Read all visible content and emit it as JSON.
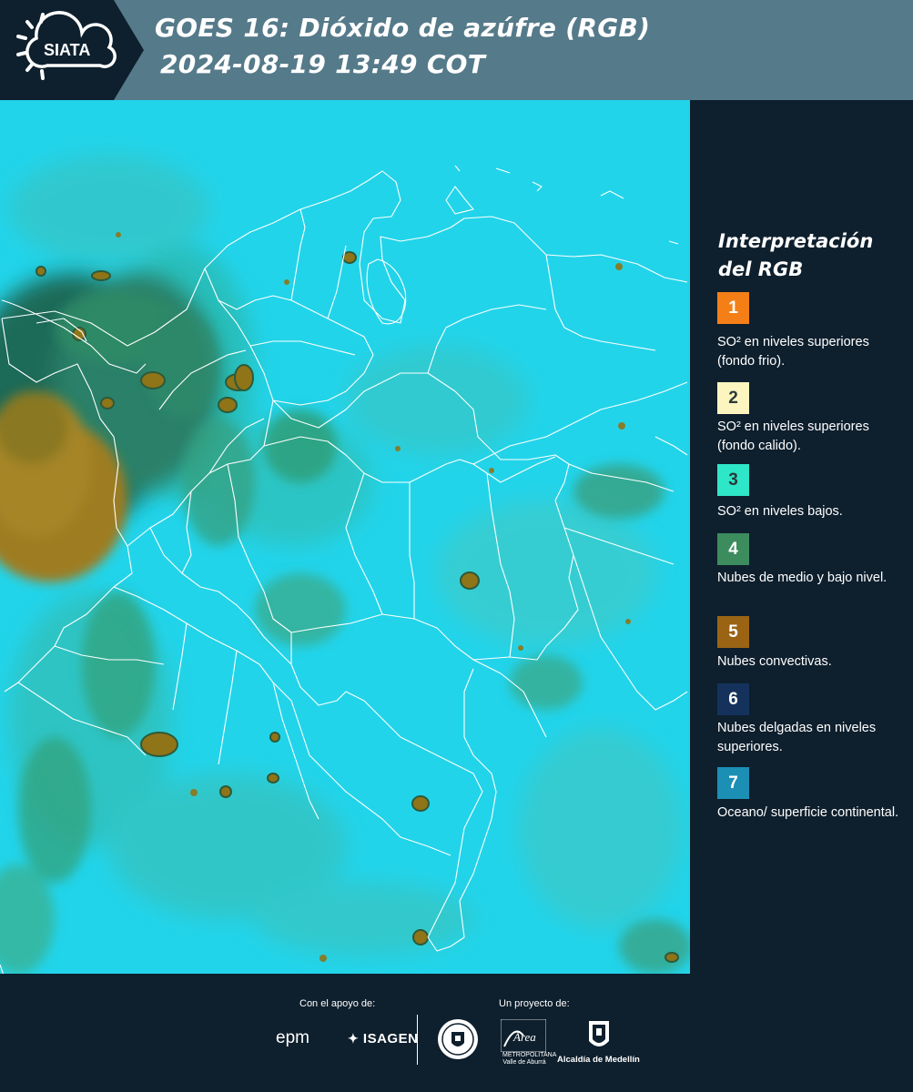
{
  "header": {
    "logo_text": "SIATA",
    "title_line1": "GOES 16: Dióxido de azúfre (RGB)",
    "title_line2": "2024-08-19 13:49 COT"
  },
  "legend": {
    "title": "Interpretación del RGB",
    "items": [
      {
        "num": "1",
        "color": "#f57f17",
        "text": "SO² en niveles superiores (fondo frio)."
      },
      {
        "num": "2",
        "color": "#fdf5c0",
        "text": "SO² en niveles superiores (fondo calido)."
      },
      {
        "num": "3",
        "color": "#2ee6c8",
        "text": "SO² en niveles bajos."
      },
      {
        "num": "4",
        "color": "#3c8c5e",
        "text": "Nubes de medio y bajo nivel."
      },
      {
        "num": "5",
        "color": "#9a6414",
        "text": "Nubes convectivas."
      },
      {
        "num": "6",
        "color": "#14325c",
        "text": "Nubes delgadas en niveles superiores."
      },
      {
        "num": "7",
        "color": "#1c8fb5",
        "text": "Oceano/ superficie continental."
      }
    ]
  },
  "footer": {
    "support_label": "Con el apoyo de:",
    "project_label": "Un proyecto de:",
    "sponsor1": "epm",
    "sponsor2": "ISAGEN",
    "area_logo": "Área",
    "area_sub": "METROPOLITANA Valle de Aburrá",
    "alcaldia": "Alcaldía de Medellín"
  },
  "map": {
    "ocean_color": "#1fcfe6",
    "land_color": "#3ad8e8",
    "cloud_color": "#3d8c5c",
    "convective_color": "#8a6a16"
  }
}
